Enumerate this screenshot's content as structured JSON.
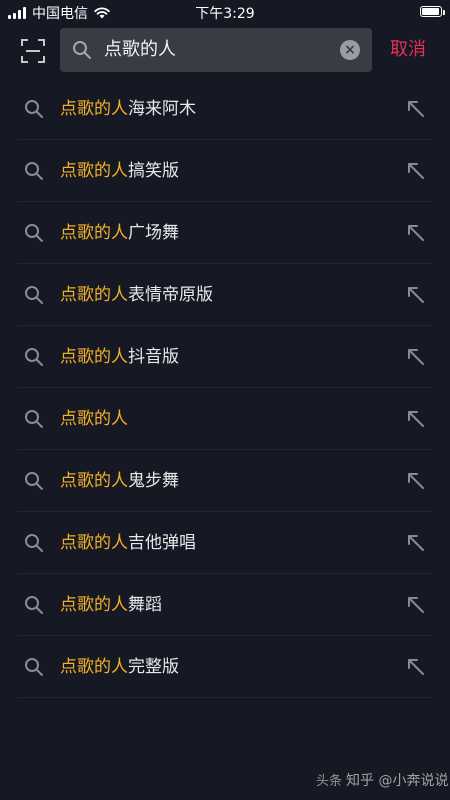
{
  "status_bar": {
    "carrier": "中国电信",
    "time": "下午3:29"
  },
  "search": {
    "query": "点歌的人",
    "cancel_label": "取消"
  },
  "suggestions": [
    {
      "highlight": "点歌的人",
      "rest": "海来阿木"
    },
    {
      "highlight": "点歌的人",
      "rest": "搞笑版"
    },
    {
      "highlight": "点歌的人",
      "rest": "广场舞"
    },
    {
      "highlight": "点歌的人",
      "rest": "表情帝原版"
    },
    {
      "highlight": "点歌的人",
      "rest": "抖音版"
    },
    {
      "highlight": "点歌的人",
      "rest": ""
    },
    {
      "highlight": "点歌的人",
      "rest": "鬼步舞"
    },
    {
      "highlight": "点歌的人",
      "rest": "吉他弹唱"
    },
    {
      "highlight": "点歌的人",
      "rest": "舞蹈"
    },
    {
      "highlight": "点歌的人",
      "rest": "完整版"
    }
  ],
  "watermark": {
    "left": "头条",
    "mid": "知乎 @小奔说说"
  },
  "colors": {
    "background": "#161823",
    "highlight": "#f2b227",
    "cancel": "#e6315a"
  },
  "icons": {
    "scan": "scan-icon",
    "search": "search-icon",
    "clear": "clear-icon",
    "fill": "arrow-up-left-icon",
    "wifi": "wifi-icon",
    "signal": "signal-icon",
    "battery": "battery-icon"
  }
}
